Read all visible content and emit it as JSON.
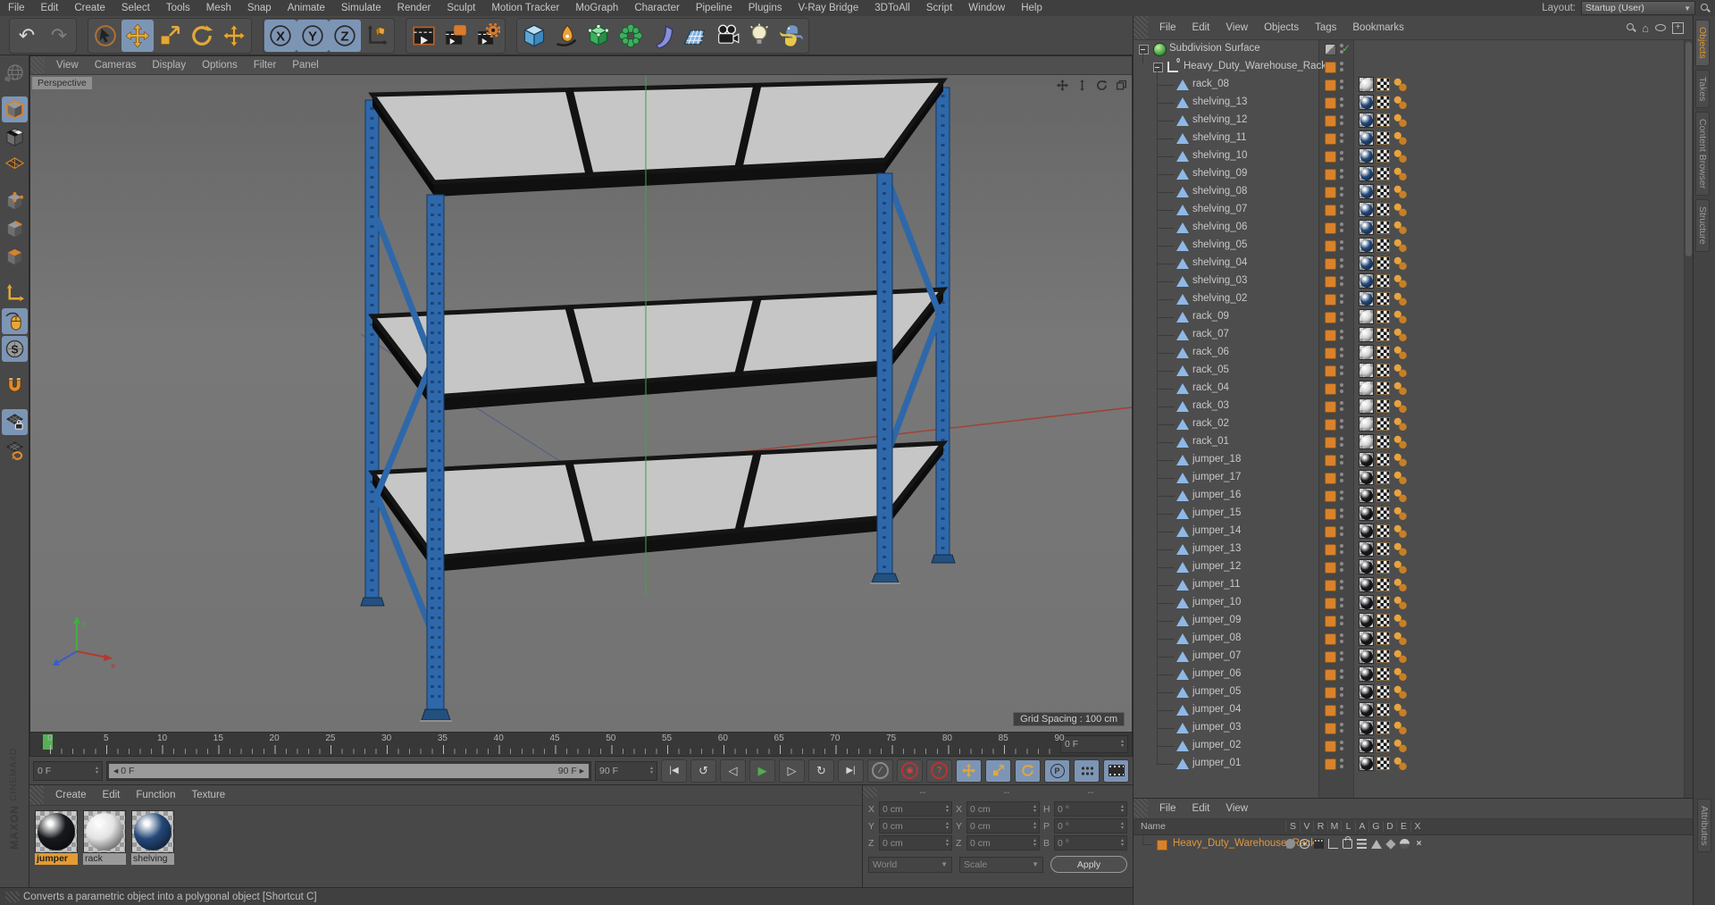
{
  "menubar": {
    "items": [
      "File",
      "Edit",
      "Create",
      "Select",
      "Tools",
      "Mesh",
      "Snap",
      "Animate",
      "Simulate",
      "Render",
      "Sculpt",
      "Motion Tracker",
      "MoGraph",
      "Character",
      "Pipeline",
      "Plugins",
      "V-Ray Bridge",
      "3DToAll",
      "Script",
      "Window",
      "Help"
    ],
    "layout_label": "Layout:",
    "layout_value": "Startup (User)"
  },
  "viewport": {
    "menu": [
      "View",
      "Cameras",
      "Display",
      "Options",
      "Filter",
      "Panel"
    ],
    "label": "Perspective",
    "grid_spacing": "Grid Spacing : 100 cm"
  },
  "timeline": {
    "tick_start": 0,
    "tick_end": 90,
    "tick_step": 5,
    "current_frame": "0 F",
    "range_start": "0 F",
    "range_end": "90 F",
    "slider_left": "0 F",
    "slider_right": "90 F"
  },
  "materials": {
    "menu": [
      "Create",
      "Edit",
      "Function",
      "Texture"
    ],
    "items": [
      {
        "name": "jumper",
        "color": "#17191d",
        "selected": true
      },
      {
        "name": "rack",
        "color": "#e2e2e2",
        "selected": false
      },
      {
        "name": "shelving",
        "color": "#24497a",
        "selected": false
      }
    ]
  },
  "coordinates": {
    "headers": [
      "--",
      "--",
      "--"
    ],
    "rows": [
      [
        [
          "X",
          "0 cm"
        ],
        [
          "X",
          "0 cm"
        ],
        [
          "H",
          "0 °"
        ]
      ],
      [
        [
          "Y",
          "0 cm"
        ],
        [
          "Y",
          "0 cm"
        ],
        [
          "P",
          "0 °"
        ]
      ],
      [
        [
          "Z",
          "0 cm"
        ],
        [
          "Z",
          "0 cm"
        ],
        [
          "B",
          "0 °"
        ]
      ]
    ],
    "dropdown_world": "World",
    "dropdown_scale": "Scale",
    "apply": "Apply"
  },
  "object_manager": {
    "menu": [
      "File",
      "Edit",
      "View",
      "Objects",
      "Tags",
      "Bookmarks"
    ],
    "tree": [
      {
        "name": "Subdivision Surface",
        "level": 0,
        "icon": "subdivision",
        "tags": "check"
      },
      {
        "name": "Heavy_Duty_Warehouse_Rack",
        "level": 1,
        "icon": "null",
        "tags": "layer"
      },
      {
        "name": "rack_08",
        "level": 2,
        "icon": "polygon",
        "mat": "silver"
      },
      {
        "name": "shelving_13",
        "level": 2,
        "icon": "polygon",
        "mat": "navy"
      },
      {
        "name": "shelving_12",
        "level": 2,
        "icon": "polygon",
        "mat": "navy"
      },
      {
        "name": "shelving_11",
        "level": 2,
        "icon": "polygon",
        "mat": "navy"
      },
      {
        "name": "shelving_10",
        "level": 2,
        "icon": "polygon",
        "mat": "navy"
      },
      {
        "name": "shelving_09",
        "level": 2,
        "icon": "polygon",
        "mat": "navy"
      },
      {
        "name": "shelving_08",
        "level": 2,
        "icon": "polygon",
        "mat": "navy"
      },
      {
        "name": "shelving_07",
        "level": 2,
        "icon": "polygon",
        "mat": "navy"
      },
      {
        "name": "shelving_06",
        "level": 2,
        "icon": "polygon",
        "mat": "navy"
      },
      {
        "name": "shelving_05",
        "level": 2,
        "icon": "polygon",
        "mat": "navy"
      },
      {
        "name": "shelving_04",
        "level": 2,
        "icon": "polygon",
        "mat": "navy"
      },
      {
        "name": "shelving_03",
        "level": 2,
        "icon": "polygon",
        "mat": "navy"
      },
      {
        "name": "shelving_02",
        "level": 2,
        "icon": "polygon",
        "mat": "navy"
      },
      {
        "name": "rack_09",
        "level": 2,
        "icon": "polygon",
        "mat": "silver"
      },
      {
        "name": "rack_07",
        "level": 2,
        "icon": "polygon",
        "mat": "silver"
      },
      {
        "name": "rack_06",
        "level": 2,
        "icon": "polygon",
        "mat": "silver"
      },
      {
        "name": "rack_05",
        "level": 2,
        "icon": "polygon",
        "mat": "silver"
      },
      {
        "name": "rack_04",
        "level": 2,
        "icon": "polygon",
        "mat": "silver"
      },
      {
        "name": "rack_03",
        "level": 2,
        "icon": "polygon",
        "mat": "silver"
      },
      {
        "name": "rack_02",
        "level": 2,
        "icon": "polygon",
        "mat": "silver"
      },
      {
        "name": "rack_01",
        "level": 2,
        "icon": "polygon",
        "mat": "silver"
      },
      {
        "name": "jumper_18",
        "level": 2,
        "icon": "polygon",
        "mat": "black"
      },
      {
        "name": "jumper_17",
        "level": 2,
        "icon": "polygon",
        "mat": "black"
      },
      {
        "name": "jumper_16",
        "level": 2,
        "icon": "polygon",
        "mat": "black"
      },
      {
        "name": "jumper_15",
        "level": 2,
        "icon": "polygon",
        "mat": "black"
      },
      {
        "name": "jumper_14",
        "level": 2,
        "icon": "polygon",
        "mat": "black"
      },
      {
        "name": "jumper_13",
        "level": 2,
        "icon": "polygon",
        "mat": "black"
      },
      {
        "name": "jumper_12",
        "level": 2,
        "icon": "polygon",
        "mat": "black"
      },
      {
        "name": "jumper_11",
        "level": 2,
        "icon": "polygon",
        "mat": "black"
      },
      {
        "name": "jumper_10",
        "level": 2,
        "icon": "polygon",
        "mat": "black"
      },
      {
        "name": "jumper_09",
        "level": 2,
        "icon": "polygon",
        "mat": "black"
      },
      {
        "name": "jumper_08",
        "level": 2,
        "icon": "polygon",
        "mat": "black"
      },
      {
        "name": "jumper_07",
        "level": 2,
        "icon": "polygon",
        "mat": "black"
      },
      {
        "name": "jumper_06",
        "level": 2,
        "icon": "polygon",
        "mat": "black"
      },
      {
        "name": "jumper_05",
        "level": 2,
        "icon": "polygon",
        "mat": "black"
      },
      {
        "name": "jumper_04",
        "level": 2,
        "icon": "polygon",
        "mat": "black"
      },
      {
        "name": "jumper_03",
        "level": 2,
        "icon": "polygon",
        "mat": "black"
      },
      {
        "name": "jumper_02",
        "level": 2,
        "icon": "polygon",
        "mat": "black"
      },
      {
        "name": "jumper_01",
        "level": 2,
        "icon": "polygon",
        "mat": "black"
      }
    ],
    "mat_colors": {
      "silver": "#d6d6d6",
      "navy": "#24497a",
      "black": "#17191d"
    }
  },
  "layer_manager": {
    "menu": [
      "File",
      "Edit",
      "View"
    ],
    "name_header": "Name",
    "columns": [
      "S",
      "V",
      "R",
      "M",
      "L",
      "A",
      "G",
      "D",
      "E",
      "X"
    ],
    "row_name": "Heavy_Duty_Warehouse_Rack",
    "layer_color": "#d9822b"
  },
  "side_tabs": {
    "top": [
      "Objects",
      "Takes",
      "Content Browser",
      "Structure"
    ],
    "active": "Objects",
    "bottom": "Attributes"
  },
  "status_bar": {
    "text": "Converts a parametric object into a polygonal object [Shortcut C]"
  },
  "branding": {
    "line1": "MAXON",
    "line2": "CINEMA4D"
  },
  "colors": {
    "accent_orange": "#d9822b",
    "active_blue": "#7d95b5",
    "upright_blue": "#2e68aa",
    "play_green": "#4fae4f"
  }
}
